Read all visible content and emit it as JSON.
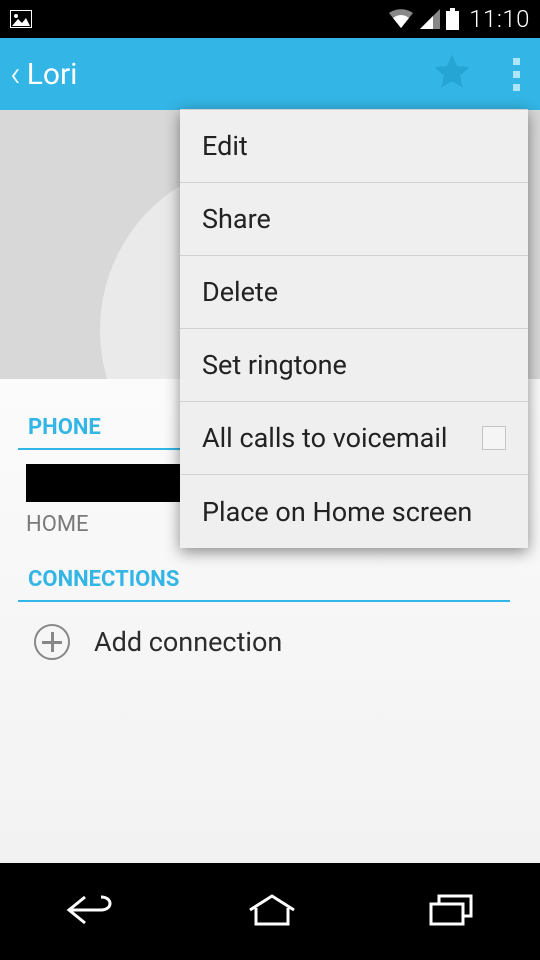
{
  "status": {
    "time": "11:10"
  },
  "header": {
    "contact_name": "Lori"
  },
  "sections": {
    "phone_label": "PHONE",
    "phone_type": "HOME",
    "connections_label": "CONNECTIONS",
    "add_connection": "Add connection"
  },
  "menu": {
    "edit": "Edit",
    "share": "Share",
    "delete": "Delete",
    "set_ringtone": "Set ringtone",
    "voicemail": "All calls to voicemail",
    "voicemail_checked": false,
    "home_screen": "Place on Home screen"
  }
}
